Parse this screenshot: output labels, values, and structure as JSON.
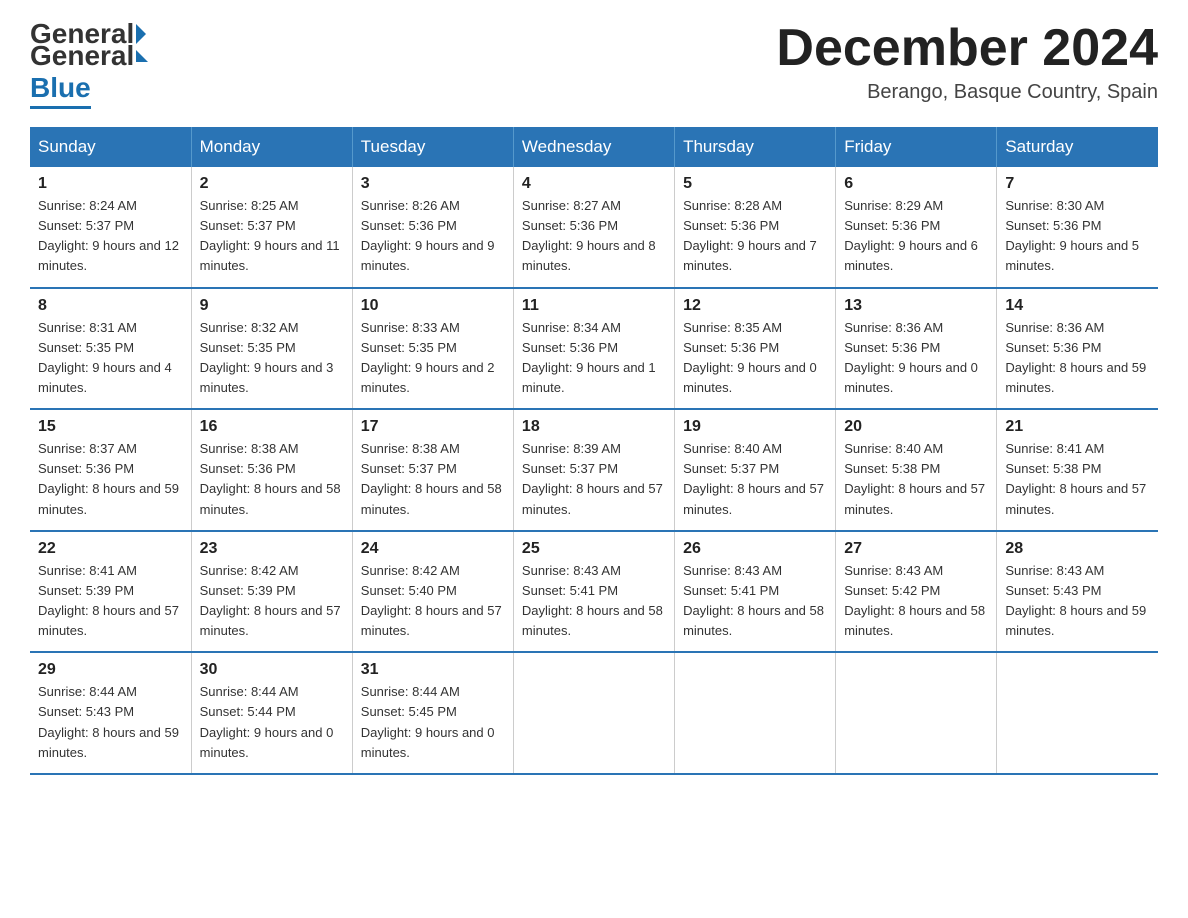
{
  "logo": {
    "general": "General",
    "blue": "Blue"
  },
  "title": "December 2024",
  "subtitle": "Berango, Basque Country, Spain",
  "days_of_week": [
    "Sunday",
    "Monday",
    "Tuesday",
    "Wednesday",
    "Thursday",
    "Friday",
    "Saturday"
  ],
  "weeks": [
    [
      {
        "day": "1",
        "sunrise": "8:24 AM",
        "sunset": "5:37 PM",
        "daylight": "9 hours and 12 minutes."
      },
      {
        "day": "2",
        "sunrise": "8:25 AM",
        "sunset": "5:37 PM",
        "daylight": "9 hours and 11 minutes."
      },
      {
        "day": "3",
        "sunrise": "8:26 AM",
        "sunset": "5:36 PM",
        "daylight": "9 hours and 9 minutes."
      },
      {
        "day": "4",
        "sunrise": "8:27 AM",
        "sunset": "5:36 PM",
        "daylight": "9 hours and 8 minutes."
      },
      {
        "day": "5",
        "sunrise": "8:28 AM",
        "sunset": "5:36 PM",
        "daylight": "9 hours and 7 minutes."
      },
      {
        "day": "6",
        "sunrise": "8:29 AM",
        "sunset": "5:36 PM",
        "daylight": "9 hours and 6 minutes."
      },
      {
        "day": "7",
        "sunrise": "8:30 AM",
        "sunset": "5:36 PM",
        "daylight": "9 hours and 5 minutes."
      }
    ],
    [
      {
        "day": "8",
        "sunrise": "8:31 AM",
        "sunset": "5:35 PM",
        "daylight": "9 hours and 4 minutes."
      },
      {
        "day": "9",
        "sunrise": "8:32 AM",
        "sunset": "5:35 PM",
        "daylight": "9 hours and 3 minutes."
      },
      {
        "day": "10",
        "sunrise": "8:33 AM",
        "sunset": "5:35 PM",
        "daylight": "9 hours and 2 minutes."
      },
      {
        "day": "11",
        "sunrise": "8:34 AM",
        "sunset": "5:36 PM",
        "daylight": "9 hours and 1 minute."
      },
      {
        "day": "12",
        "sunrise": "8:35 AM",
        "sunset": "5:36 PM",
        "daylight": "9 hours and 0 minutes."
      },
      {
        "day": "13",
        "sunrise": "8:36 AM",
        "sunset": "5:36 PM",
        "daylight": "9 hours and 0 minutes."
      },
      {
        "day": "14",
        "sunrise": "8:36 AM",
        "sunset": "5:36 PM",
        "daylight": "8 hours and 59 minutes."
      }
    ],
    [
      {
        "day": "15",
        "sunrise": "8:37 AM",
        "sunset": "5:36 PM",
        "daylight": "8 hours and 59 minutes."
      },
      {
        "day": "16",
        "sunrise": "8:38 AM",
        "sunset": "5:36 PM",
        "daylight": "8 hours and 58 minutes."
      },
      {
        "day": "17",
        "sunrise": "8:38 AM",
        "sunset": "5:37 PM",
        "daylight": "8 hours and 58 minutes."
      },
      {
        "day": "18",
        "sunrise": "8:39 AM",
        "sunset": "5:37 PM",
        "daylight": "8 hours and 57 minutes."
      },
      {
        "day": "19",
        "sunrise": "8:40 AM",
        "sunset": "5:37 PM",
        "daylight": "8 hours and 57 minutes."
      },
      {
        "day": "20",
        "sunrise": "8:40 AM",
        "sunset": "5:38 PM",
        "daylight": "8 hours and 57 minutes."
      },
      {
        "day": "21",
        "sunrise": "8:41 AM",
        "sunset": "5:38 PM",
        "daylight": "8 hours and 57 minutes."
      }
    ],
    [
      {
        "day": "22",
        "sunrise": "8:41 AM",
        "sunset": "5:39 PM",
        "daylight": "8 hours and 57 minutes."
      },
      {
        "day": "23",
        "sunrise": "8:42 AM",
        "sunset": "5:39 PM",
        "daylight": "8 hours and 57 minutes."
      },
      {
        "day": "24",
        "sunrise": "8:42 AM",
        "sunset": "5:40 PM",
        "daylight": "8 hours and 57 minutes."
      },
      {
        "day": "25",
        "sunrise": "8:43 AM",
        "sunset": "5:41 PM",
        "daylight": "8 hours and 58 minutes."
      },
      {
        "day": "26",
        "sunrise": "8:43 AM",
        "sunset": "5:41 PM",
        "daylight": "8 hours and 58 minutes."
      },
      {
        "day": "27",
        "sunrise": "8:43 AM",
        "sunset": "5:42 PM",
        "daylight": "8 hours and 58 minutes."
      },
      {
        "day": "28",
        "sunrise": "8:43 AM",
        "sunset": "5:43 PM",
        "daylight": "8 hours and 59 minutes."
      }
    ],
    [
      {
        "day": "29",
        "sunrise": "8:44 AM",
        "sunset": "5:43 PM",
        "daylight": "8 hours and 59 minutes."
      },
      {
        "day": "30",
        "sunrise": "8:44 AM",
        "sunset": "5:44 PM",
        "daylight": "9 hours and 0 minutes."
      },
      {
        "day": "31",
        "sunrise": "8:44 AM",
        "sunset": "5:45 PM",
        "daylight": "9 hours and 0 minutes."
      },
      null,
      null,
      null,
      null
    ]
  ],
  "labels": {
    "sunrise": "Sunrise:",
    "sunset": "Sunset:",
    "daylight": "Daylight:"
  }
}
